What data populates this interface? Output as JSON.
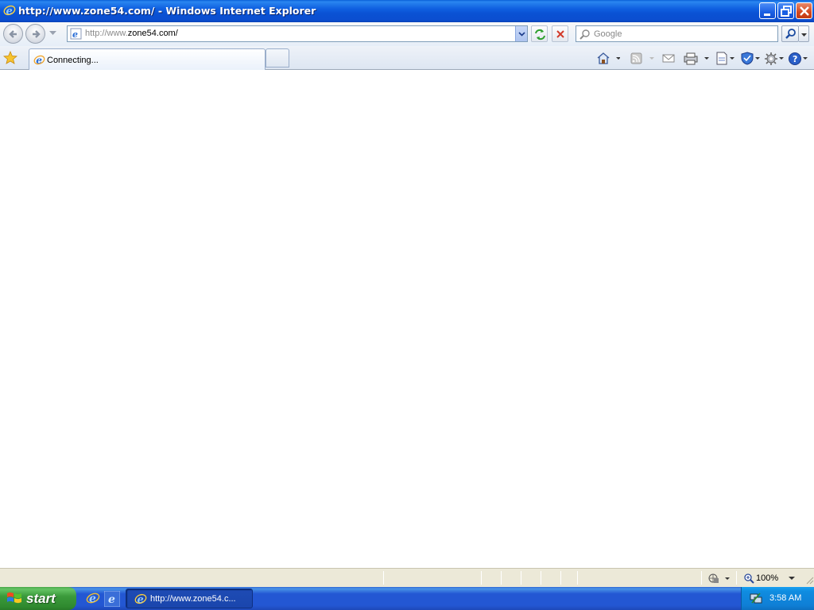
{
  "window": {
    "title": "http://www.zone54.com/ - Windows Internet Explorer"
  },
  "navbar": {
    "back_icon": "back-arrow-icon",
    "forward_icon": "forward-arrow-icon",
    "address_prefix": "http://www.",
    "address_domain": "zone54.com/",
    "search_placeholder": "Google"
  },
  "tabs": [
    {
      "label": "Connecting...",
      "active": true
    }
  ],
  "command_bar": [
    "home-icon",
    "feeds-icon",
    "read-mail-icon",
    "print-icon",
    "page-icon",
    "safety-icon",
    "tools-icon",
    "help-icon"
  ],
  "statusbar": {
    "zoom": "100%"
  },
  "taskbar": {
    "start_label": "start",
    "task_label": "http://www.zone54.c...",
    "clock": "3:58 AM"
  },
  "colors": {
    "titlebar": "#0a52d4",
    "taskbar": "#2357d3",
    "start": "#3b9a3b",
    "tray": "#0f7fd6"
  }
}
